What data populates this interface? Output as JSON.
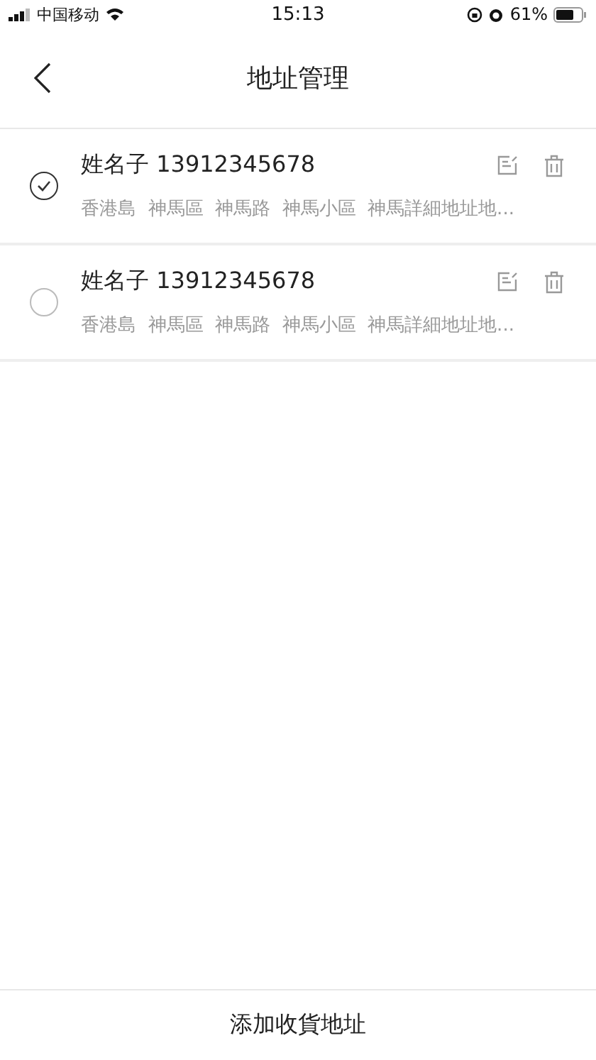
{
  "status_bar": {
    "carrier": "中国移动",
    "time": "15:13",
    "battery": "61%"
  },
  "nav": {
    "title": "地址管理"
  },
  "addresses": [
    {
      "selected": true,
      "name": "姓名子 13912345678",
      "address": "香港島  神馬區  神馬路  神馬小區  神馬詳細地址地..."
    },
    {
      "selected": false,
      "name": "姓名子 13912345678",
      "address": "香港島  神馬區  神馬路  神馬小區  神馬詳細地址地..."
    }
  ],
  "footer": {
    "button": "添加收貨地址"
  }
}
